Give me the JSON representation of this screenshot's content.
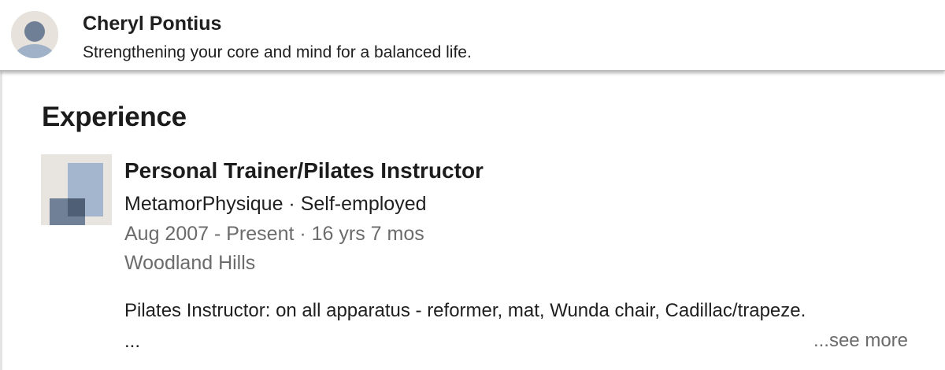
{
  "header": {
    "name": "Cheryl Pontius",
    "headline": "Strengthening your core and mind for a balanced life.",
    "avatar_icon": "default-person-avatar"
  },
  "experience": {
    "title": "Experience",
    "items": [
      {
        "logo_icon": "generic-company-logo",
        "title": "Personal Trainer/Pilates Instructor",
        "company_line": "MetamorPhysique · Self-employed",
        "dates": "Aug 2007 - Present · 16 yrs 7 mos",
        "location": "Woodland Hills",
        "description": "Pilates Instructor: on all apparatus - reformer, mat, Wunda chair, Cadillac/trapeze.",
        "ellipsis": "...",
        "see_more_label": "...see more"
      }
    ]
  },
  "colors": {
    "text_primary": "#1f1f1f",
    "text_secondary": "#6b6b6b",
    "avatar_bg": "#e7e2dc",
    "avatar_fg": "#8da0b8",
    "logo_light": "#a3b6cd",
    "logo_dark": "#5b6d85"
  }
}
